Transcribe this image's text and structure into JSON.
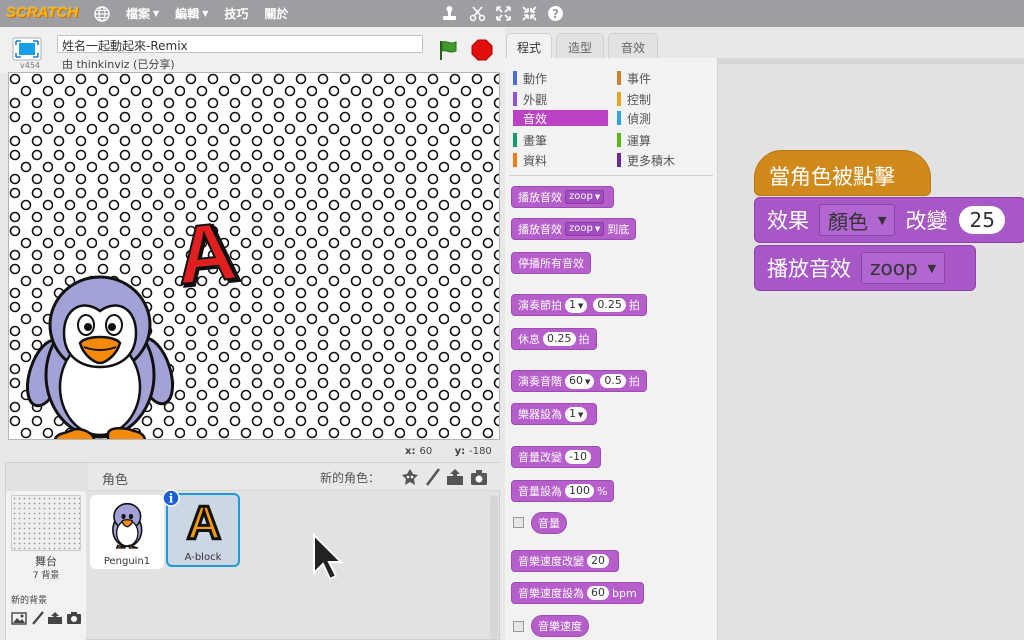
{
  "menubar": {
    "logo": "SCRATCH",
    "items": [
      "檔案",
      "編輯",
      "技巧",
      "關於"
    ]
  },
  "stage_header": {
    "version": "v454",
    "project_title": "姓名一起動起來-Remix",
    "byline": "由 thinkinviz (已分享)"
  },
  "stage": {
    "letter": "A",
    "x_label": "x:",
    "x_value": "60",
    "y_label": "y:",
    "y_value": "-180"
  },
  "sprite_pane": {
    "title": "角色",
    "new_sprite_label": "新的角色：",
    "stage_label": "舞台",
    "stage_count": "7 背景",
    "new_backdrop_label": "新的背景",
    "sprites": [
      {
        "name": "Penguin1",
        "selected": false
      },
      {
        "name": "A-block",
        "selected": true
      }
    ]
  },
  "tabs": [
    "程式",
    "造型",
    "音效"
  ],
  "categories": {
    "left": [
      {
        "label": "動作",
        "color": "#4a6cd4"
      },
      {
        "label": "外觀",
        "color": "#8a55d7"
      },
      {
        "label": "音效",
        "color": "#bb42c3"
      },
      {
        "label": "畫筆",
        "color": "#0e9a6c"
      },
      {
        "label": "資料",
        "color": "#ee7d16"
      }
    ],
    "right": [
      {
        "label": "事件",
        "color": "#c88330"
      },
      {
        "label": "控制",
        "color": "#e1a91a"
      },
      {
        "label": "偵測",
        "color": "#2ca5e2"
      },
      {
        "label": "運算",
        "color": "#5cb712"
      },
      {
        "label": "更多積木",
        "color": "#632d99"
      }
    ]
  },
  "palette_blocks": {
    "play_sound": "播放音效",
    "play_sound_until_done_a": "播放音效",
    "play_sound_until_done_b": "到底",
    "sound_name": "zoop",
    "stop_all_sounds": "停播所有音效",
    "play_drum_a": "演奏節拍",
    "play_drum_num": "1",
    "play_drum_beats": "0.25",
    "play_drum_b": "拍",
    "rest_a": "休息",
    "rest_beats": "0.25",
    "rest_b": "拍",
    "play_note_a": "演奏音階",
    "play_note_num": "60",
    "play_note_beats": "0.5",
    "play_note_b": "拍",
    "set_instrument": "樂器設為",
    "instrument_num": "1",
    "change_volume": "音量改變",
    "change_volume_value": "-10",
    "set_volume": "音量設為",
    "set_volume_value": "100",
    "set_volume_unit": "%",
    "volume_reporter": "音量",
    "change_tempo": "音樂速度改變",
    "change_tempo_value": "20",
    "set_tempo": "音樂速度設為",
    "set_tempo_value": "60",
    "set_tempo_unit": "bpm",
    "tempo_reporter": "音樂速度"
  },
  "script": {
    "hat": "當角色被點擊",
    "effect_label": "效果",
    "effect_dropdown": "顏色",
    "change_label": "改變",
    "change_value": "25",
    "play_sound_label": "播放音效",
    "sound_dropdown": "zoop"
  }
}
